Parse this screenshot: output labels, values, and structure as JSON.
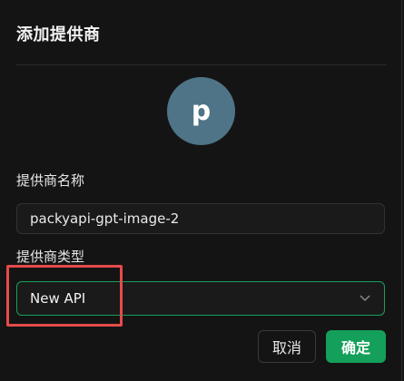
{
  "dialog": {
    "title": "添加提供商",
    "avatar_letter": "p",
    "fields": {
      "name_label": "提供商名称",
      "name_value": "packyapi-gpt-image-2",
      "type_label": "提供商类型",
      "type_value": "New API"
    },
    "buttons": {
      "cancel_label": "取消",
      "confirm_label": "确定"
    }
  },
  "colors": {
    "background": "#141414",
    "avatar": "#4f7487",
    "accent_green": "#14a05a",
    "highlight_red": "#e64b4b"
  },
  "icons": {
    "select_chevron": "chevron-down-icon"
  }
}
